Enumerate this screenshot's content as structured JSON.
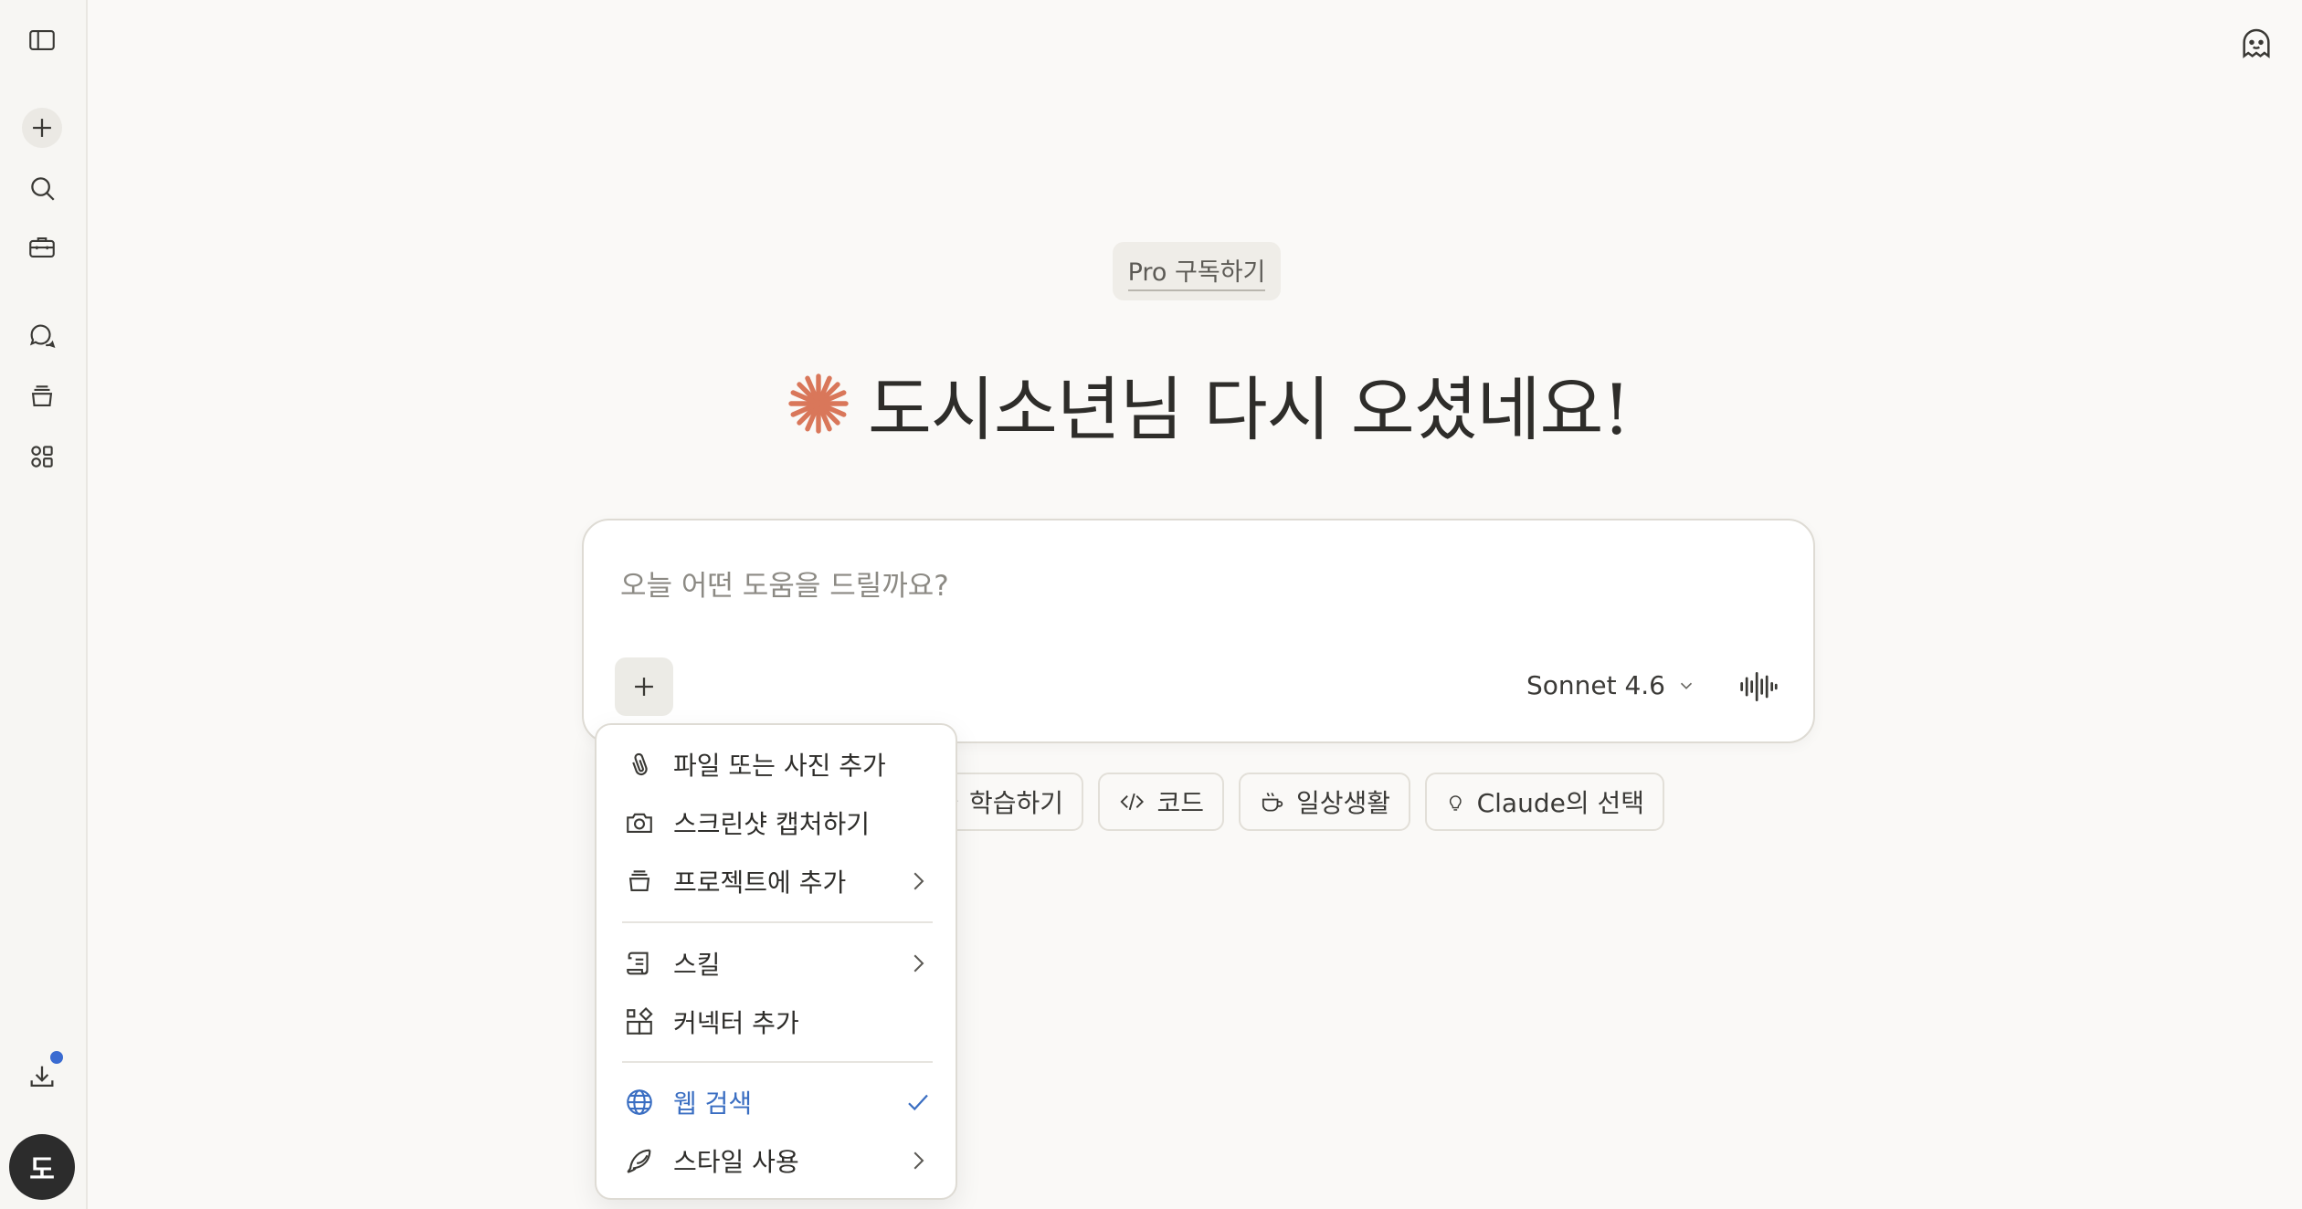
{
  "pro_badge": "Pro 구독하기",
  "greeting": "도시소년님 다시 오셨네요!",
  "composer": {
    "placeholder": "오늘 어떤 도움을 드릴까요?",
    "model": "Sonnet 4.6"
  },
  "avatar_initial": "도",
  "chips": [
    {
      "label": "학습하기",
      "icon": "graduation-icon"
    },
    {
      "label": "코드",
      "icon": "code-icon"
    },
    {
      "label": "일상생활",
      "icon": "coffee-icon"
    },
    {
      "label": "Claude의 선택",
      "icon": "lightbulb-icon"
    }
  ],
  "menu": {
    "items": [
      {
        "label": "파일 또는 사진 추가",
        "icon": "paperclip-icon"
      },
      {
        "label": "스크린샷 캡처하기",
        "icon": "camera-icon"
      },
      {
        "label": "프로젝트에 추가",
        "icon": "project-icon",
        "submenu": true
      },
      {
        "label": "스킬",
        "icon": "skill-icon",
        "submenu": true
      },
      {
        "label": "커넥터 추가",
        "icon": "connector-icon"
      },
      {
        "label": "웹 검색",
        "icon": "globe-icon",
        "checked": true
      },
      {
        "label": "스타일 사용",
        "icon": "feather-icon",
        "submenu": true
      }
    ]
  },
  "colors": {
    "accent_orange": "#d9775a",
    "active_blue": "#3a6ec2",
    "background": "#faf9f7"
  }
}
